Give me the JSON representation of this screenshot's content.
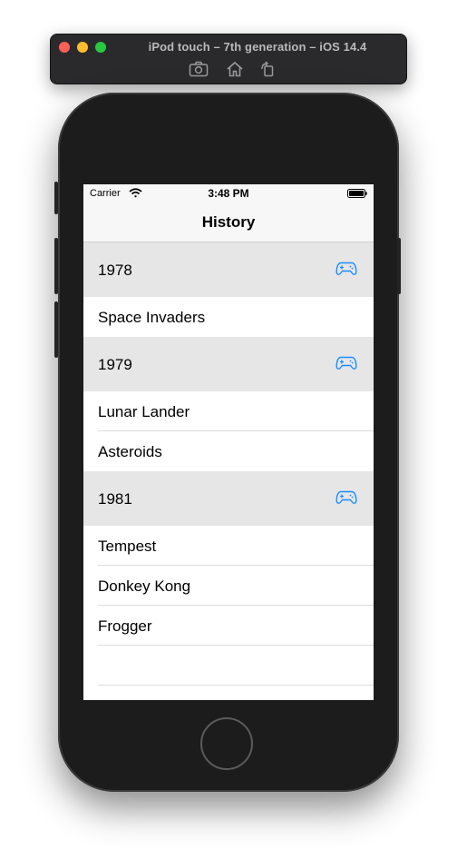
{
  "simulator": {
    "title": "iPod touch – 7th generation – iOS 14.4",
    "tools": [
      "screenshot-icon",
      "home-icon",
      "rotate-icon"
    ]
  },
  "status_bar": {
    "carrier": "Carrier",
    "time": "3:48 PM"
  },
  "nav": {
    "title": "History"
  },
  "colors": {
    "accent": "#1a8cff",
    "header_bg": "#e6e6e6",
    "bar_bg": "#f7f7f7"
  },
  "sections": [
    {
      "year": "1978",
      "icon": "gamecontroller-icon",
      "items": [
        "Space Invaders"
      ]
    },
    {
      "year": "1979",
      "icon": "gamecontroller-icon",
      "items": [
        "Lunar Lander",
        "Asteroids"
      ]
    },
    {
      "year": "1981",
      "icon": "gamecontroller-icon",
      "items": [
        "Tempest",
        "Donkey Kong",
        "Frogger"
      ]
    }
  ]
}
